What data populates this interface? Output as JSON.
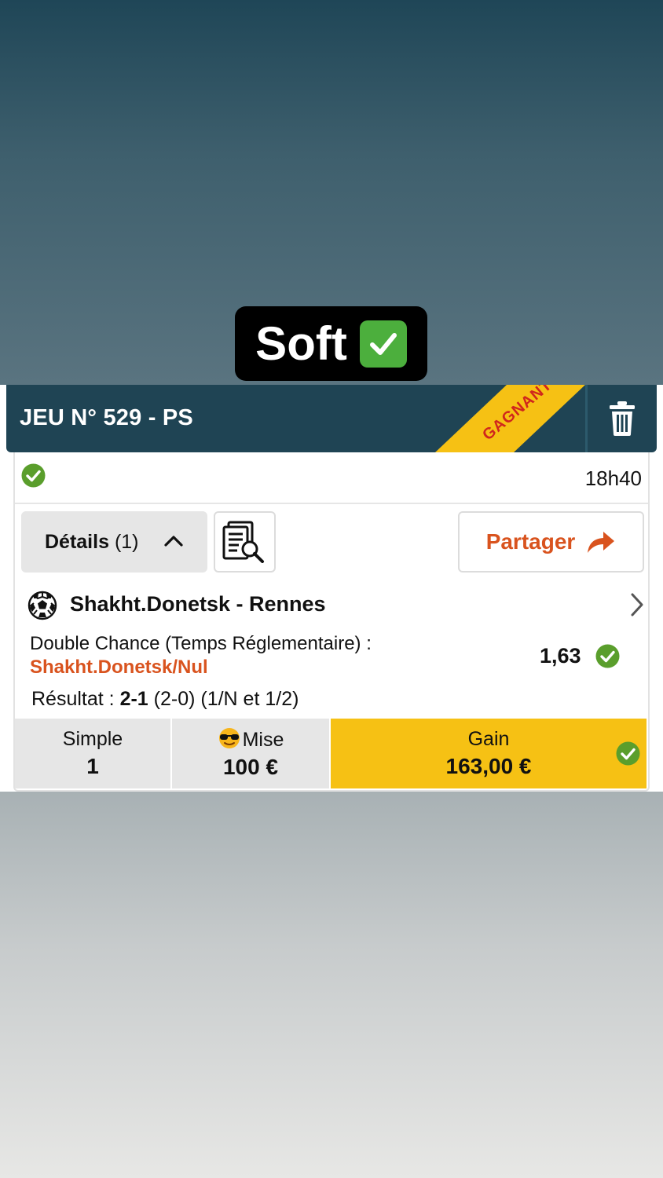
{
  "caption": {
    "text": "Soft",
    "emoji": "check-emoji"
  },
  "ticket": {
    "title": "JEU N° 529 - PS",
    "ribbon": "GAGNANT",
    "time": "18h40",
    "details_label": "Détails",
    "details_count": "(1)",
    "share_label": "Partager"
  },
  "match": {
    "name": "Shakht.Donetsk - Rennes",
    "market": "Double Chance (Temps Réglementaire) :",
    "selection": "Shakht.Donetsk/Nul",
    "odds": "1,63",
    "result_label": "Résultat :",
    "result_score": "2-1",
    "result_detail": "(2-0) (1/N et 1/2)"
  },
  "footer": {
    "simple_label": "Simple",
    "simple_value": "1",
    "mise_label": "Mise",
    "mise_value": "100 €",
    "gain_label": "Gain",
    "gain_value": "163,00 €"
  },
  "colors": {
    "header": "#1f4454",
    "accent": "#d9531e",
    "ribbon": "#f6c114",
    "success": "#5a9e2c",
    "gain": "#f6c114"
  }
}
